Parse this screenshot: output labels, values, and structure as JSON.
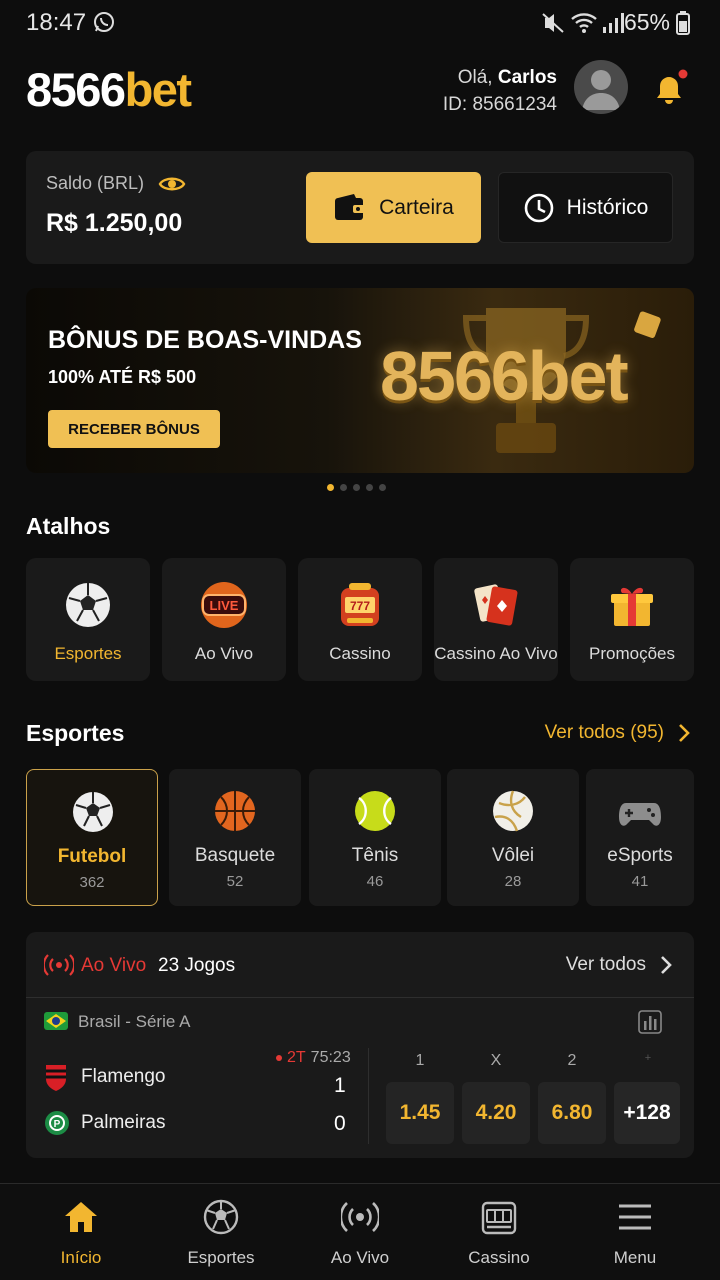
{
  "status_bar": {
    "time": "18:47",
    "battery": "65%"
  },
  "header": {
    "logo_white": "8566",
    "logo_gold": "bet",
    "greeting": "Olá,",
    "user_name": "Carlos",
    "user_id": "ID: 85661234"
  },
  "balance": {
    "label": "Saldo (BRL)",
    "value": "R$ 1.250,00",
    "wallet_label": "Carteira",
    "history_label": "Histórico"
  },
  "banner": {
    "title": "BÔNUS DE BOAS-VINDAS",
    "subtitle": "100% ATÉ R$ 500",
    "cta": "RECEBER BÔNUS",
    "brand": "8566bet",
    "active_slide": 1,
    "slides": 5
  },
  "shortcuts": {
    "title": "Atalhos",
    "items": [
      {
        "label": "Esportes",
        "icon": "soccer-ball-icon",
        "active": true
      },
      {
        "label": "Ao Vivo",
        "icon": "live-badge-icon"
      },
      {
        "label": "Cassino",
        "icon": "slot-machine-icon"
      },
      {
        "label": "Cassino Ao Vivo",
        "icon": "cards-icon"
      },
      {
        "label": "Promoções",
        "icon": "gift-icon"
      }
    ]
  },
  "sports": {
    "title": "Esportes",
    "see_all": "Ver todos (95)",
    "items": [
      {
        "name": "Futebol",
        "count": "362",
        "icon": "soccer-ball-icon"
      },
      {
        "name": "Basquete",
        "count": "52",
        "icon": "basketball-icon"
      },
      {
        "name": "Tênis",
        "count": "46",
        "icon": "tennis-ball-icon"
      },
      {
        "name": "Vôlei",
        "count": "28",
        "icon": "volleyball-icon"
      },
      {
        "name": "eSports",
        "count": "41",
        "icon": "gamepad-icon"
      }
    ]
  },
  "live": {
    "label": "Ao Vivo",
    "games": "23 Jogos",
    "see_all": "Ver todos",
    "league": "Brasil - Série A",
    "period": "2T",
    "clock": "75:23",
    "home": {
      "name": "Flamengo",
      "score": "1"
    },
    "away": {
      "name": "Palmeiras",
      "score": "0"
    },
    "odds_headers": [
      "1",
      "X",
      "2",
      "+"
    ],
    "odds": [
      "1.45",
      "4.20",
      "6.80"
    ],
    "more_markets": "+128"
  },
  "nav": {
    "items": [
      {
        "label": "Início",
        "icon": "home-icon"
      },
      {
        "label": "Esportes",
        "icon": "soccer-ball-icon"
      },
      {
        "label": "Ao Vivo",
        "icon": "broadcast-icon"
      },
      {
        "label": "Cassino",
        "icon": "slot-machine-icon"
      },
      {
        "label": "Menu",
        "icon": "menu-icon"
      }
    ]
  },
  "colors": {
    "accent": "#f2b630",
    "button_gold": "#f0c054",
    "live_red": "#e53935",
    "card_bg": "#1a1a1a"
  }
}
